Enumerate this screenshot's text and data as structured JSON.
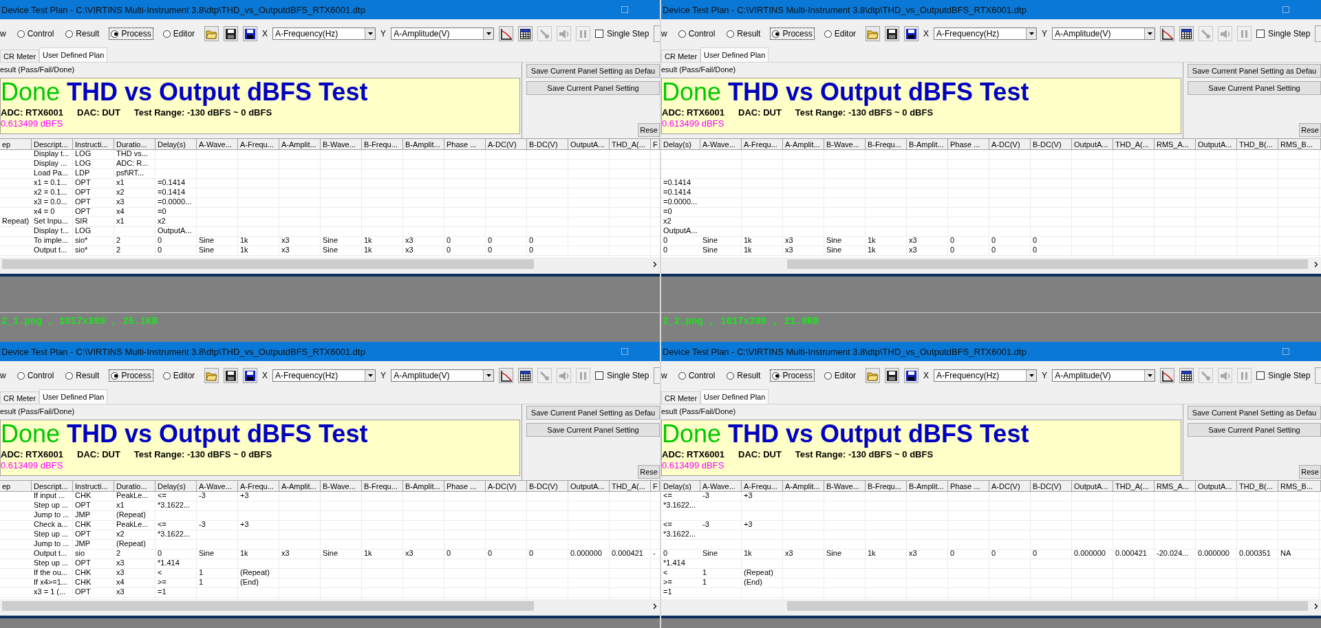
{
  "tiles": [
    {
      "window": {
        "title": "Device Test Plan - C:\\VIRTINS Multi-Instrument 3.8\\dtp\\THD_vs_OutputdBFS_RTX6001.dtp",
        "toolbar": {
          "lead": "w",
          "modes": [
            {
              "label": "Control",
              "selected": false
            },
            {
              "label": "Result",
              "selected": false
            },
            {
              "label": "Process",
              "selected": true
            },
            {
              "label": "Editor",
              "selected": false
            }
          ],
          "file_buttons": [
            {
              "kind": "open"
            },
            {
              "kind": "save"
            },
            {
              "kind": "save_as"
            }
          ],
          "x_label": "X",
          "x_select": "A-Frequency(Hz)",
          "y_label": "Y",
          "y_select": "A-Amplitude(V)",
          "view_buttons": [
            {
              "kind": "chart",
              "disabled": false
            },
            {
              "kind": "table",
              "disabled": false
            },
            {
              "kind": "probe",
              "disabled": true
            },
            {
              "kind": "speaker",
              "disabled": true
            },
            {
              "kind": "pause",
              "disabled": true
            }
          ],
          "single_step": {
            "label": "Single Step",
            "checked": false
          }
        },
        "tabs": [
          {
            "label": "CR Meter",
            "selected": false
          },
          {
            "label": "User Defined Plan",
            "selected": true
          }
        ],
        "result_label": "esult (Pass/Fail/Done)",
        "result": {
          "status": "Done",
          "heading": "THD vs Output dBFS Test",
          "info": [
            "ADC: RTX6001",
            "DAC: DUT",
            "Test Range: -130 dBFS ~ 0 dBFS"
          ],
          "value": "0.613499 dBFS"
        },
        "buttons": [
          "Save Current Panel Setting as Defau",
          "Save Current Panel Setting",
          "Rese"
        ],
        "table": {
          "columns": [
            "ep",
            "Descript...",
            "Instructi...",
            "Duratio...",
            "Delay(s)",
            "A-Wave...",
            "A-Frequ...",
            "A-Amplit...",
            "B-Wave...",
            "B-Frequ...",
            "B-Amplit...",
            "Phase ...",
            "A-DC(V)",
            "B-DC(V)",
            "OutputA...",
            "THD_A(...",
            "F"
          ],
          "rows": [
            [
              null,
              "Display t...",
              "LOG",
              "THD vs..."
            ],
            [
              null,
              "Display ...",
              "LOG",
              "ADC: R..."
            ],
            [
              null,
              "Load Pa...",
              "LDP",
              "psf\\RT..."
            ],
            [
              null,
              "x1 = 0.1...",
              "OPT",
              "x1",
              "=0.1414"
            ],
            [
              null,
              "x2 = 0.1...",
              "OPT",
              "x2",
              "=0.1414"
            ],
            [
              null,
              "x3 = 0.0...",
              "OPT",
              "x3",
              "=0.0000..."
            ],
            [
              null,
              "x4 = 0",
              "OPT",
              "x4",
              "=0"
            ],
            [
              "Repeat)",
              "Set Inpu...",
              "SIR",
              "x1",
              "x2"
            ],
            [
              null,
              "Display t...",
              "LOG",
              null,
              "OutputA..."
            ],
            [
              null,
              "To imple...",
              "sio*",
              "2",
              "0",
              "Sine",
              "1k",
              "x3",
              "Sine",
              "1k",
              "x3",
              "0",
              "0",
              "0"
            ],
            [
              null,
              "Output t...",
              "sio*",
              "2",
              "0",
              "Sine",
              "1k",
              "x3",
              "Sine",
              "1k",
              "x3",
              "0",
              "0",
              "0"
            ]
          ]
        }
      },
      "caption": "2_1.png , 1017x399 , 25.1KB"
    },
    {
      "window": {
        "title": "Device Test Plan - C:\\VIRTINS Multi-Instrument 3.8\\dtp\\THD_vs_OutputdBFS_RTX6001.dtp",
        "toolbar": {
          "lead": "w",
          "modes": [
            {
              "label": "Control",
              "selected": false
            },
            {
              "label": "Result",
              "selected": false
            },
            {
              "label": "Process",
              "selected": true
            },
            {
              "label": "Editor",
              "selected": false
            }
          ],
          "file_buttons": [
            {
              "kind": "open"
            },
            {
              "kind": "save"
            },
            {
              "kind": "save_as"
            }
          ],
          "x_label": "X",
          "x_select": "A-Frequency(Hz)",
          "y_label": "Y",
          "y_select": "A-Amplitude(V)",
          "view_buttons": [
            {
              "kind": "chart",
              "disabled": false
            },
            {
              "kind": "table",
              "disabled": false
            },
            {
              "kind": "probe",
              "disabled": true
            },
            {
              "kind": "speaker",
              "disabled": true
            },
            {
              "kind": "pause",
              "disabled": true
            }
          ],
          "single_step": {
            "label": "Single Step",
            "checked": false
          }
        },
        "tabs": [
          {
            "label": "CR Meter",
            "selected": false
          },
          {
            "label": "User Defined Plan",
            "selected": true
          }
        ],
        "result_label": "esult (Pass/Fail/Done)",
        "result": {
          "status": "Done",
          "heading": "THD vs Output dBFS Test",
          "info": [
            "ADC: RTX6001",
            "DAC: DUT",
            "Test Range: -130 dBFS ~ 0 dBFS"
          ],
          "value": "0.613499 dBFS"
        },
        "buttons": [
          "Save Current Panel Setting as Defau",
          "Save Current Panel Setting",
          "Rese"
        ],
        "table": {
          "columns": [
            "Delay(s)",
            "A-Wave...",
            "A-Frequ...",
            "A-Amplit...",
            "B-Wave...",
            "B-Frequ...",
            "B-Amplit...",
            "Phase ...",
            "A-DC(V)",
            "B-DC(V)",
            "OutputA...",
            "THD_A(...",
            "RMS_A...",
            "OutputA...",
            "THD_B(...",
            "RMS_B..."
          ],
          "rows": [
            [],
            [],
            [],
            [
              "=0.1414"
            ],
            [
              "=0.1414"
            ],
            [
              "=0.0000..."
            ],
            [
              "=0"
            ],
            [
              "x2"
            ],
            [
              "OutputA..."
            ],
            [
              "0",
              "Sine",
              "1k",
              "x3",
              "Sine",
              "1k",
              "x3",
              "0",
              "0",
              "0"
            ],
            [
              "0",
              "Sine",
              "1k",
              "x3",
              "Sine",
              "1k",
              "x3",
              "0",
              "0",
              "0"
            ]
          ]
        }
      },
      "caption": "2_2.png , 1017x399 , 21.9KB"
    },
    {
      "window": {
        "title": "Device Test Plan - C:\\VIRTINS Multi-Instrument 3.8\\dtp\\THD_vs_OutputdBFS_RTX6001.dtp",
        "toolbar": {
          "lead": "w",
          "modes": [
            {
              "label": "Control",
              "selected": false
            },
            {
              "label": "Result",
              "selected": false
            },
            {
              "label": "Process",
              "selected": true
            },
            {
              "label": "Editor",
              "selected": false
            }
          ],
          "file_buttons": [
            {
              "kind": "open"
            },
            {
              "kind": "save"
            },
            {
              "kind": "save_as"
            }
          ],
          "x_label": "X",
          "x_select": "A-Frequency(Hz)",
          "y_label": "Y",
          "y_select": "A-Amplitude(V)",
          "view_buttons": [
            {
              "kind": "chart",
              "disabled": false
            },
            {
              "kind": "table",
              "disabled": false
            },
            {
              "kind": "probe",
              "disabled": true
            },
            {
              "kind": "speaker",
              "disabled": true
            },
            {
              "kind": "pause",
              "disabled": true
            }
          ],
          "single_step": {
            "label": "Single Step",
            "checked": false
          }
        },
        "tabs": [
          {
            "label": "CR Meter",
            "selected": false
          },
          {
            "label": "User Defined Plan",
            "selected": true
          }
        ],
        "result_label": "esult (Pass/Fail/Done)",
        "result": {
          "status": "Done",
          "heading": "THD vs Output dBFS Test",
          "info": [
            "ADC: RTX6001",
            "DAC: DUT",
            "Test Range: -130 dBFS ~ 0 dBFS"
          ],
          "value": "0.613499 dBFS"
        },
        "buttons": [
          "Save Current Panel Setting as Defau",
          "Save Current Panel Setting",
          "Rese"
        ],
        "table": {
          "columns": [
            "ep",
            "Descript...",
            "Instructi...",
            "Duratio...",
            "Delay(s)",
            "A-Wave...",
            "A-Frequ...",
            "A-Amplit...",
            "B-Wave...",
            "B-Frequ...",
            "B-Amplit...",
            "Phase ...",
            "A-DC(V)",
            "B-DC(V)",
            "OutputA...",
            "THD_A(...",
            "F"
          ],
          "rows": [
            [
              null,
              "If input ...",
              "CHK",
              "PeakLe...",
              "<=",
              "-3",
              "+3"
            ],
            [
              null,
              "Step up ...",
              "OPT",
              "x1",
              "*3.1622..."
            ],
            [
              null,
              "Jump to ...",
              "JMP",
              "(Repeat)"
            ],
            [
              null,
              "Check a...",
              "CHK",
              "PeakLe...",
              "<=",
              "-3",
              "+3"
            ],
            [
              null,
              "Step up ...",
              "OPT",
              "x2",
              "*3.1622..."
            ],
            [
              null,
              "Jump to ...",
              "JMP",
              "(Repeat)"
            ],
            [
              null,
              "Output t...",
              "sio",
              "2",
              "0",
              "Sine",
              "1k",
              "x3",
              "Sine",
              "1k",
              "x3",
              "0",
              "0",
              "0",
              "0.000000",
              "0.000421",
              "-"
            ],
            [
              null,
              "Step up ...",
              "OPT",
              "x3",
              "*1.414"
            ],
            [
              null,
              "If the ou...",
              "CHK",
              "x3",
              "<",
              "1",
              "(Repeat)"
            ],
            [
              null,
              "If x4>=1...",
              "CHK",
              "x4",
              ">=",
              "1",
              "(End)"
            ],
            [
              null,
              "x3 = 1 (...",
              "OPT",
              "x3",
              "=1"
            ]
          ]
        }
      }
    },
    {
      "window": {
        "title": "Device Test Plan - C:\\VIRTINS Multi-Instrument 3.8\\dtp\\THD_vs_OutputdBFS_RTX6001.dtp",
        "toolbar": {
          "lead": "w",
          "modes": [
            {
              "label": "Control",
              "selected": false
            },
            {
              "label": "Result",
              "selected": false
            },
            {
              "label": "Process",
              "selected": true
            },
            {
              "label": "Editor",
              "selected": false
            }
          ],
          "file_buttons": [
            {
              "kind": "open"
            },
            {
              "kind": "save"
            },
            {
              "kind": "save_as"
            }
          ],
          "x_label": "X",
          "x_select": "A-Frequency(Hz)",
          "y_label": "Y",
          "y_select": "A-Amplitude(V)",
          "view_buttons": [
            {
              "kind": "chart",
              "disabled": false
            },
            {
              "kind": "table",
              "disabled": false
            },
            {
              "kind": "probe",
              "disabled": true
            },
            {
              "kind": "speaker",
              "disabled": true
            },
            {
              "kind": "pause",
              "disabled": true
            }
          ],
          "single_step": {
            "label": "Single Step",
            "checked": false
          }
        },
        "tabs": [
          {
            "label": "CR Meter",
            "selected": false
          },
          {
            "label": "User Defined Plan",
            "selected": true
          }
        ],
        "result_label": "esult (Pass/Fail/Done)",
        "result": {
          "status": "Done",
          "heading": "THD vs Output dBFS Test",
          "info": [
            "ADC: RTX6001",
            "DAC: DUT",
            "Test Range: -130 dBFS ~ 0 dBFS"
          ],
          "value": "0.613499 dBFS"
        },
        "buttons": [
          "Save Current Panel Setting as Defau",
          "Save Current Panel Setting",
          "Rese"
        ],
        "table": {
          "columns": [
            "Delay(s)",
            "A-Wave...",
            "A-Frequ...",
            "A-Amplit...",
            "B-Wave...",
            "B-Frequ...",
            "B-Amplit...",
            "Phase ...",
            "A-DC(V)",
            "B-DC(V)",
            "OutputA...",
            "THD_A(...",
            "RMS_A...",
            "OutputA...",
            "THD_B(...",
            "RMS_B..."
          ],
          "rows": [
            [
              "<=",
              "-3",
              "+3"
            ],
            [
              "*3.1622..."
            ],
            [],
            [
              "<=",
              "-3",
              "+3"
            ],
            [
              "*3.1622..."
            ],
            [],
            [
              "0",
              "Sine",
              "1k",
              "x3",
              "Sine",
              "1k",
              "x3",
              "0",
              "0",
              "0",
              "0.000000",
              "0.000421",
              "-20.024...",
              "0.000000",
              "0.000351",
              "NA"
            ],
            [
              "*1.414"
            ],
            [
              "<",
              "1",
              "(Repeat)"
            ],
            [
              ">=",
              "1",
              "(End)"
            ],
            [
              "=1"
            ]
          ]
        }
      }
    }
  ]
}
